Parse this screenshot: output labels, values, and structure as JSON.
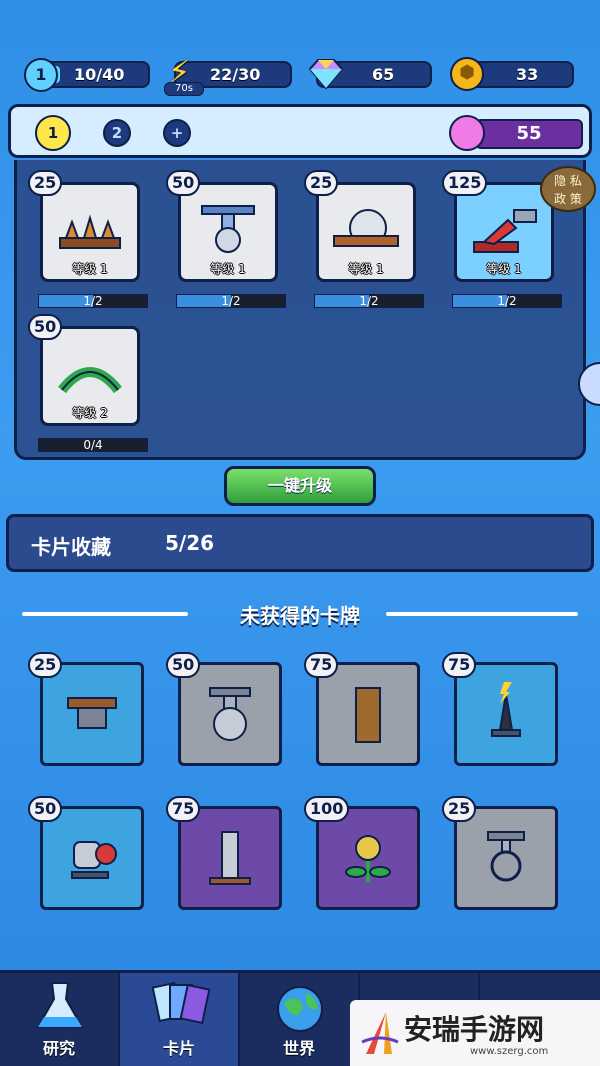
{
  "resources": {
    "lives": "10/40",
    "lives_badge": "1",
    "energy": "22/30",
    "energy_timer": "70s",
    "gems": "65",
    "coins": "33"
  },
  "slots": {
    "tabs": [
      "1",
      "2",
      "+"
    ],
    "potion_count": "55"
  },
  "privacy_button": "隐 私\n政 策",
  "deck_cards": [
    {
      "cost": "25",
      "level": "等级 1",
      "progress": "1/2",
      "progress_fraction": 0.5
    },
    {
      "cost": "50",
      "level": "等级 1",
      "progress": "1/2",
      "progress_fraction": 0.5
    },
    {
      "cost": "25",
      "level": "等级 1",
      "progress": "1/2",
      "progress_fraction": 0.5
    },
    {
      "cost": "125",
      "level": "等级 1",
      "progress": "1/2",
      "progress_fraction": 0.5
    },
    {
      "cost": "50",
      "level": "等级 2",
      "progress": "0/4",
      "progress_fraction": 0
    }
  ],
  "upgrade_all_label": "一键升级",
  "collection": {
    "label": "卡片收藏",
    "count": "5/26"
  },
  "locked_section_title": "未获得的卡牌",
  "locked_cards": [
    {
      "cost": "25"
    },
    {
      "cost": "50"
    },
    {
      "cost": "75"
    },
    {
      "cost": "75"
    },
    {
      "cost": "50"
    },
    {
      "cost": "75"
    },
    {
      "cost": "100"
    },
    {
      "cost": "25"
    }
  ],
  "nav": [
    "研究",
    "卡片",
    "世界"
  ],
  "watermark": {
    "title": "安瑞手游网",
    "url": "www.szerg.com"
  },
  "colors": {
    "accent_green": "#2f9e3c",
    "panel_dark": "#0e1f49",
    "potion_purple": "#6b2fa0"
  }
}
